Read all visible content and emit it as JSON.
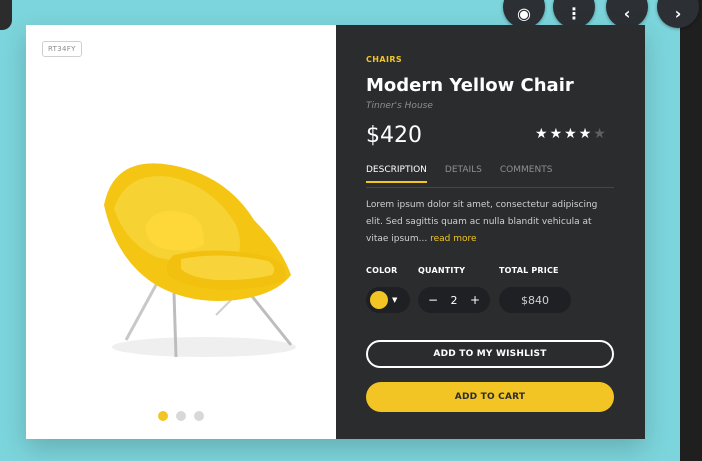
{
  "overlay": {
    "buttons": [
      {
        "name": "lens",
        "glyph": "◉"
      },
      {
        "name": "more",
        "glyph": "⋮"
      },
      {
        "name": "prev",
        "glyph": "‹"
      },
      {
        "name": "next",
        "glyph": "›"
      }
    ]
  },
  "product": {
    "sku": "RT34FY",
    "category": "CHAIRS",
    "title": "Modern Yellow Chair",
    "brand": "Tinner's House",
    "price": "$420",
    "rating": 4,
    "rating_max": 5
  },
  "tabs": [
    "DESCRIPTION",
    "DETAILS",
    "COMMENTS"
  ],
  "description": {
    "text": "Lorem ipsum dolor sit amet, consectetur adipiscing elit. Sed sagittis quam ac nulla blandit vehicula at vitae ipsum...",
    "read_more": "read more"
  },
  "options": {
    "color_label": "COLOR",
    "quantity_label": "QUANTITY",
    "total_label": "TOTAL PRICE",
    "quantity_minus": "−",
    "quantity_value": "2",
    "quantity_plus": "+",
    "total_value": "$840",
    "color_value": "#f2c524"
  },
  "actions": {
    "wishlist": "ADD TO MY WISHLIST",
    "cart": "ADD TO CART"
  },
  "carousel": {
    "count": 3,
    "active_index": 0
  },
  "colors": {
    "accent": "#f2c524",
    "panel": "#2b2c2e",
    "background": "#7cd5dc"
  }
}
